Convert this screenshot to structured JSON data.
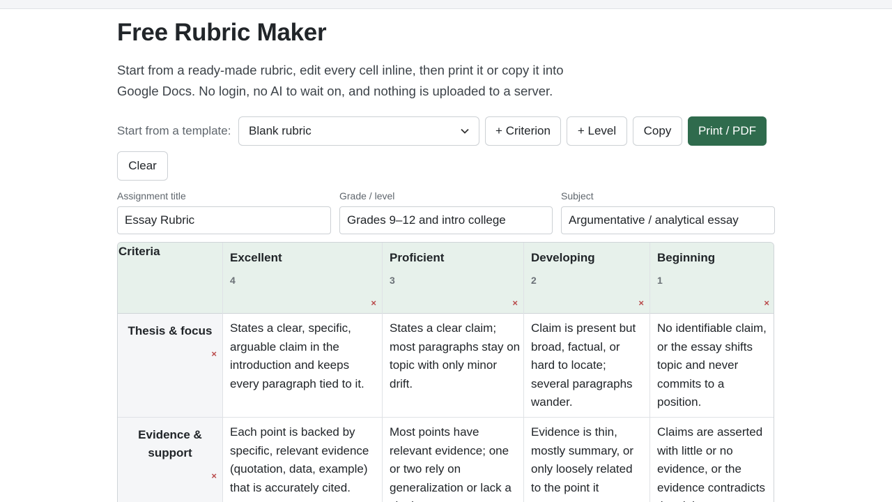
{
  "page": {
    "title": "Free Rubric Maker",
    "intro": "Start from a ready-made rubric, edit every cell inline, then print it or copy it into Google Docs. No login, no AI to wait on, and nothing is uploaded to a server."
  },
  "toolbar": {
    "template_label": "Start from a template:",
    "template_value": "Blank rubric",
    "add_criterion": "+ Criterion",
    "add_level": "+ Level",
    "copy": "Copy",
    "print": "Print / PDF",
    "clear": "Clear"
  },
  "fields": {
    "assignment": {
      "label": "Assignment title",
      "value": "Essay Rubric"
    },
    "grade": {
      "label": "Grade / level",
      "value": "Grades 9–12 and intro college"
    },
    "subject": {
      "label": "Subject",
      "value": "Argumentative / analytical essay"
    }
  },
  "rubric": {
    "criteria_header": "Criteria",
    "remove_glyph": "×",
    "levels": [
      {
        "name": "Excellent",
        "score": "4"
      },
      {
        "name": "Proficient",
        "score": "3"
      },
      {
        "name": "Developing",
        "score": "2"
      },
      {
        "name": "Beginning",
        "score": "1"
      }
    ],
    "rows": [
      {
        "criterion": "Thesis & focus",
        "cells": [
          "States a clear, specific, arguable claim in the introduction and keeps every paragraph tied to it.",
          "States a clear claim; most paragraphs stay on topic with only minor drift.",
          "Claim is present but broad, factual, or hard to locate; several paragraphs wander.",
          "No identifiable claim, or the essay shifts topic and never commits to a position."
        ]
      },
      {
        "criterion": "Evidence & support",
        "cells": [
          "Each point is backed by specific, relevant evidence (quotation, data, example) that is accurately cited.",
          "Most points have relevant evidence; one or two rely on generalization or lack a citation.",
          "Evidence is thin, mostly summary, or only loosely related to the point it supports.",
          "Claims are asserted with little or no evidence, or the evidence contradicts the claim."
        ]
      }
    ]
  }
}
